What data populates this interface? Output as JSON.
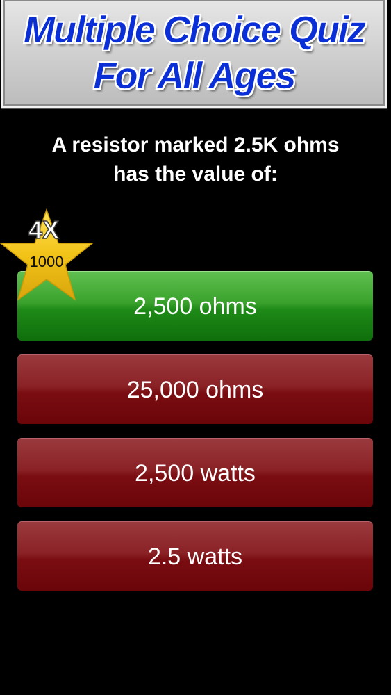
{
  "header": {
    "title_line1": "Multiple Choice Quiz",
    "title_line2": "For All Ages"
  },
  "question": {
    "line1": "A resistor marked 2.5K ohms",
    "line2": "has the value of:"
  },
  "bonus": {
    "multiplier": "4X",
    "points": "1000",
    "icon": "star-icon",
    "color": "#f2c318"
  },
  "answers": [
    {
      "label": "2,500 ohms",
      "state": "correct",
      "color": "#2f9a24"
    },
    {
      "label": "25,000 ohms",
      "state": "wrong",
      "color": "#8a1a1f"
    },
    {
      "label": "2,500 watts",
      "state": "wrong",
      "color": "#8a1a1f"
    },
    {
      "label": "2.5 watts",
      "state": "wrong",
      "color": "#8a1a1f"
    }
  ]
}
